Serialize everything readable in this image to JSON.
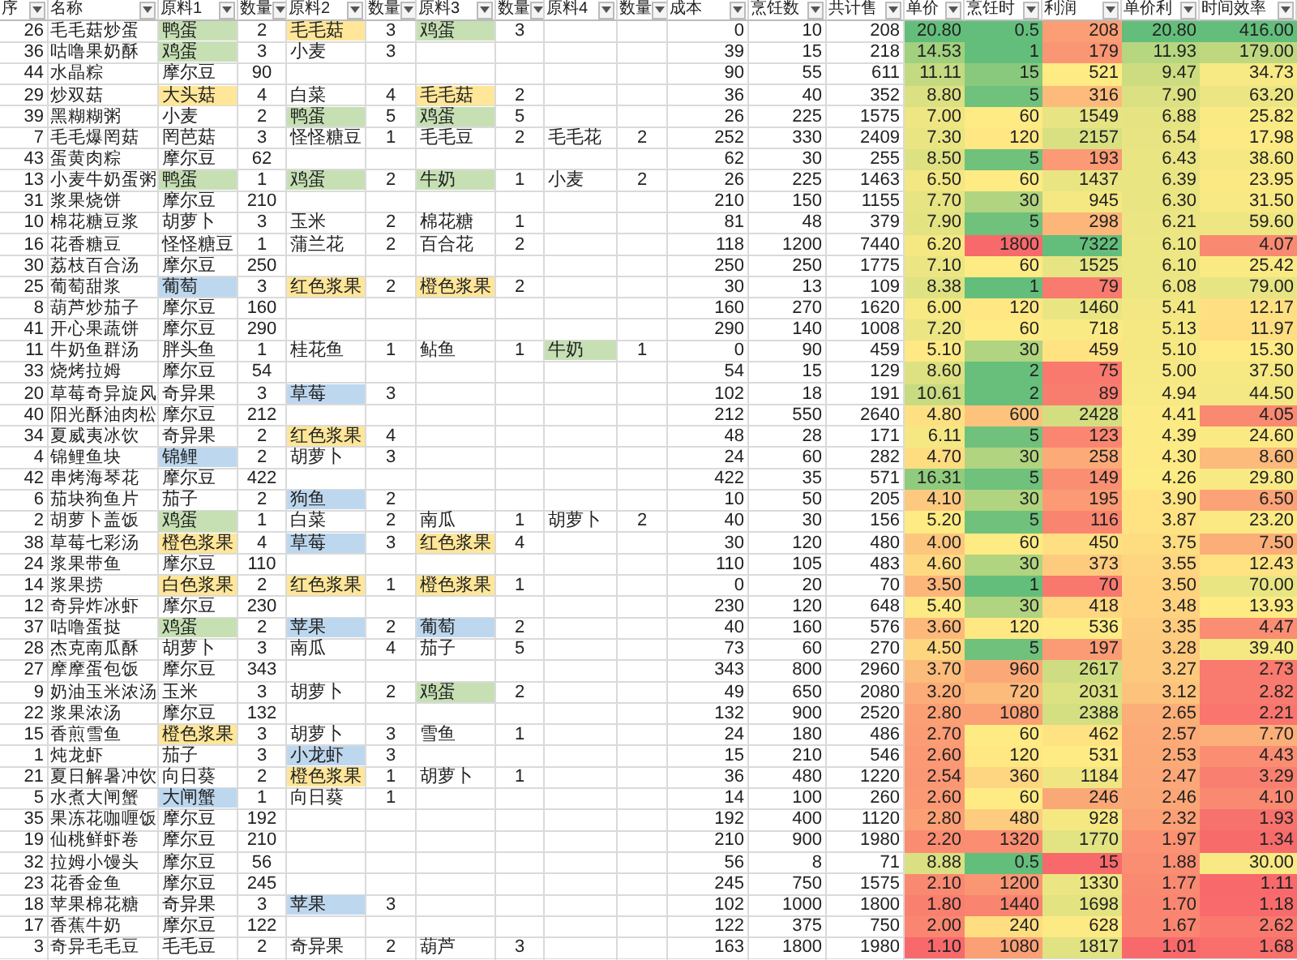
{
  "table": {
    "columns": [
      "序",
      "名称",
      "原料1",
      "数量",
      "原料2",
      "数量",
      "原料3",
      "数量",
      "原料4",
      "数量",
      "成本",
      "烹饪数",
      "共计售",
      "单价",
      "烹饪时",
      "利润",
      "单价利",
      "时间效率"
    ],
    "rows": [
      {
        "id": "26",
        "name": "毛毛菇炒蛋",
        "ingredients": [
          {
            "name": "鸭蛋",
            "qty": "2",
            "color": "#c6e0b4"
          },
          {
            "name": "毛毛菇",
            "qty": "3",
            "color": "#ffe699"
          },
          {
            "name": "鸡蛋",
            "qty": "3",
            "color": "#c6e0b4"
          }
        ],
        "cost": "0",
        "cook_count": "10",
        "total_price": "208",
        "unit_price": "20.80",
        "cook_time": "0.5",
        "profit": "208",
        "unit_profit": "20.80",
        "time_efficiency": "416.00"
      },
      {
        "id": "36",
        "name": "咕噜果奶酥",
        "ingredients": [
          {
            "name": "鸡蛋",
            "qty": "3",
            "color": "#c6e0b4"
          },
          {
            "name": "小麦",
            "qty": "3"
          }
        ],
        "cost": "39",
        "cook_count": "15",
        "total_price": "218",
        "unit_price": "14.53",
        "cook_time": "1",
        "profit": "179",
        "unit_profit": "11.93",
        "time_efficiency": "179.00"
      },
      {
        "id": "44",
        "name": "水晶粽",
        "ingredients": [
          {
            "name": "摩尔豆",
            "qty": "90"
          }
        ],
        "cost": "90",
        "cook_count": "55",
        "total_price": "611",
        "unit_price": "11.11",
        "cook_time": "15",
        "profit": "521",
        "unit_profit": "9.47",
        "time_efficiency": "34.73"
      },
      {
        "id": "29",
        "name": "炒双菇",
        "ingredients": [
          {
            "name": "大头菇",
            "qty": "4",
            "color": "#ffe699"
          },
          {
            "name": "白菜",
            "qty": "4"
          },
          {
            "name": "毛毛菇",
            "qty": "2",
            "color": "#ffe699"
          }
        ],
        "cost": "36",
        "cook_count": "40",
        "total_price": "352",
        "unit_price": "8.80",
        "cook_time": "5",
        "profit": "316",
        "unit_profit": "7.90",
        "time_efficiency": "63.20"
      },
      {
        "id": "39",
        "name": "黑糊糊粥",
        "ingredients": [
          {
            "name": "小麦",
            "qty": "2"
          },
          {
            "name": "鸭蛋",
            "qty": "5",
            "color": "#c6e0b4"
          },
          {
            "name": "鸡蛋",
            "qty": "5",
            "color": "#c6e0b4"
          }
        ],
        "cost": "26",
        "cook_count": "225",
        "total_price": "1575",
        "unit_price": "7.00",
        "cook_time": "60",
        "profit": "1549",
        "unit_profit": "6.88",
        "time_efficiency": "25.82"
      },
      {
        "id": "7",
        "name": "毛毛爆罔菇",
        "ingredients": [
          {
            "name": "罔芭菇",
            "qty": "3"
          },
          {
            "name": "怪怪糖豆",
            "qty": "1"
          },
          {
            "name": "毛毛豆",
            "qty": "2"
          },
          {
            "name": "毛毛花",
            "qty": "2"
          }
        ],
        "cost": "252",
        "cook_count": "330",
        "total_price": "2409",
        "unit_price": "7.30",
        "cook_time": "120",
        "profit": "2157",
        "unit_profit": "6.54",
        "time_efficiency": "17.98"
      },
      {
        "id": "43",
        "name": "蛋黄肉粽",
        "ingredients": [
          {
            "name": "摩尔豆",
            "qty": "62"
          }
        ],
        "cost": "62",
        "cook_count": "30",
        "total_price": "255",
        "unit_price": "8.50",
        "cook_time": "5",
        "profit": "193",
        "unit_profit": "6.43",
        "time_efficiency": "38.60"
      },
      {
        "id": "13",
        "name": "小麦牛奶蛋粥",
        "ingredients": [
          {
            "name": "鸭蛋",
            "qty": "1",
            "color": "#c6e0b4"
          },
          {
            "name": "鸡蛋",
            "qty": "2",
            "color": "#c6e0b4"
          },
          {
            "name": "牛奶",
            "qty": "1",
            "color": "#c6e0b4"
          },
          {
            "name": "小麦",
            "qty": "2"
          }
        ],
        "cost": "26",
        "cook_count": "225",
        "total_price": "1463",
        "unit_price": "6.50",
        "cook_time": "60",
        "profit": "1437",
        "unit_profit": "6.39",
        "time_efficiency": "23.95"
      },
      {
        "id": "31",
        "name": "浆果烧饼",
        "ingredients": [
          {
            "name": "摩尔豆",
            "qty": "210"
          }
        ],
        "cost": "210",
        "cook_count": "150",
        "total_price": "1155",
        "unit_price": "7.70",
        "cook_time": "30",
        "profit": "945",
        "unit_profit": "6.30",
        "time_efficiency": "31.50"
      },
      {
        "id": "10",
        "name": "棉花糖豆浆",
        "ingredients": [
          {
            "name": "胡萝卜",
            "qty": "3"
          },
          {
            "name": "玉米",
            "qty": "2"
          },
          {
            "name": "棉花糖",
            "qty": "1"
          }
        ],
        "cost": "81",
        "cook_count": "48",
        "total_price": "379",
        "unit_price": "7.90",
        "cook_time": "5",
        "profit": "298",
        "unit_profit": "6.21",
        "time_efficiency": "59.60"
      },
      {
        "id": "16",
        "name": "花香糖豆",
        "ingredients": [
          {
            "name": "怪怪糖豆",
            "qty": "1"
          },
          {
            "name": "蒲兰花",
            "qty": "2"
          },
          {
            "name": "百合花",
            "qty": "2"
          }
        ],
        "cost": "118",
        "cook_count": "1200",
        "total_price": "7440",
        "unit_price": "6.20",
        "cook_time": "1800",
        "profit": "7322",
        "unit_profit": "6.10",
        "time_efficiency": "4.07"
      },
      {
        "id": "30",
        "name": "荔枝百合汤",
        "ingredients": [
          {
            "name": "摩尔豆",
            "qty": "250"
          }
        ],
        "cost": "250",
        "cook_count": "250",
        "total_price": "1775",
        "unit_price": "7.10",
        "cook_time": "60",
        "profit": "1525",
        "unit_profit": "6.10",
        "time_efficiency": "25.42"
      },
      {
        "id": "25",
        "name": "葡萄甜浆",
        "ingredients": [
          {
            "name": "葡萄",
            "qty": "3",
            "color": "#bdd7ee"
          },
          {
            "name": "红色浆果",
            "qty": "2",
            "color": "#ffe699"
          },
          {
            "name": "橙色浆果",
            "qty": "2",
            "color": "#ffe699"
          }
        ],
        "cost": "30",
        "cook_count": "13",
        "total_price": "109",
        "unit_price": "8.38",
        "cook_time": "1",
        "profit": "79",
        "unit_profit": "6.08",
        "time_efficiency": "79.00"
      },
      {
        "id": "8",
        "name": "葫芦炒茄子",
        "ingredients": [
          {
            "name": "摩尔豆",
            "qty": "160"
          }
        ],
        "cost": "160",
        "cook_count": "270",
        "total_price": "1620",
        "unit_price": "6.00",
        "cook_time": "120",
        "profit": "1460",
        "unit_profit": "5.41",
        "time_efficiency": "12.17"
      },
      {
        "id": "41",
        "name": "开心果蔬饼",
        "ingredients": [
          {
            "name": "摩尔豆",
            "qty": "290"
          }
        ],
        "cost": "290",
        "cook_count": "140",
        "total_price": "1008",
        "unit_price": "7.20",
        "cook_time": "60",
        "profit": "718",
        "unit_profit": "5.13",
        "time_efficiency": "11.97"
      },
      {
        "id": "11",
        "name": "牛奶鱼群汤",
        "ingredients": [
          {
            "name": "胖头鱼",
            "qty": "1"
          },
          {
            "name": "桂花鱼",
            "qty": "1"
          },
          {
            "name": "鲇鱼",
            "qty": "1"
          },
          {
            "name": "牛奶",
            "qty": "1",
            "color": "#c6e0b4"
          }
        ],
        "cost": "0",
        "cook_count": "90",
        "total_price": "459",
        "unit_price": "5.10",
        "cook_time": "30",
        "profit": "459",
        "unit_profit": "5.10",
        "time_efficiency": "15.30"
      },
      {
        "id": "33",
        "name": "烧烤拉姆",
        "ingredients": [
          {
            "name": "摩尔豆",
            "qty": "54"
          }
        ],
        "cost": "54",
        "cook_count": "15",
        "total_price": "129",
        "unit_price": "8.60",
        "cook_time": "2",
        "profit": "75",
        "unit_profit": "5.00",
        "time_efficiency": "37.50"
      },
      {
        "id": "20",
        "name": "草莓奇异旋风",
        "ingredients": [
          {
            "name": "奇异果",
            "qty": "3"
          },
          {
            "name": "草莓",
            "qty": "3",
            "color": "#bdd7ee"
          }
        ],
        "cost": "102",
        "cook_count": "18",
        "total_price": "191",
        "unit_price": "10.61",
        "cook_time": "2",
        "profit": "89",
        "unit_profit": "4.94",
        "time_efficiency": "44.50"
      },
      {
        "id": "40",
        "name": "阳光酥油肉松",
        "ingredients": [
          {
            "name": "摩尔豆",
            "qty": "212"
          }
        ],
        "cost": "212",
        "cook_count": "550",
        "total_price": "2640",
        "unit_price": "4.80",
        "cook_time": "600",
        "profit": "2428",
        "unit_profit": "4.41",
        "time_efficiency": "4.05"
      },
      {
        "id": "34",
        "name": "夏威夷冰饮",
        "ingredients": [
          {
            "name": "奇异果",
            "qty": "2"
          },
          {
            "name": "红色浆果",
            "qty": "4",
            "color": "#ffe699"
          }
        ],
        "cost": "48",
        "cook_count": "28",
        "total_price": "171",
        "unit_price": "6.11",
        "cook_time": "5",
        "profit": "123",
        "unit_profit": "4.39",
        "time_efficiency": "24.60"
      },
      {
        "id": "4",
        "name": "锦鲤鱼块",
        "ingredients": [
          {
            "name": "锦鲤",
            "qty": "2",
            "color": "#bdd7ee"
          },
          {
            "name": "胡萝卜",
            "qty": "3"
          }
        ],
        "cost": "24",
        "cook_count": "60",
        "total_price": "282",
        "unit_price": "4.70",
        "cook_time": "30",
        "profit": "258",
        "unit_profit": "4.30",
        "time_efficiency": "8.60"
      },
      {
        "id": "42",
        "name": "串烤海琴花",
        "ingredients": [
          {
            "name": "摩尔豆",
            "qty": "422"
          }
        ],
        "cost": "422",
        "cook_count": "35",
        "total_price": "571",
        "unit_price": "16.31",
        "cook_time": "5",
        "profit": "149",
        "unit_profit": "4.26",
        "time_efficiency": "29.80"
      },
      {
        "id": "6",
        "name": "茄块狗鱼片",
        "ingredients": [
          {
            "name": "茄子",
            "qty": "2"
          },
          {
            "name": "狗鱼",
            "qty": "2",
            "color": "#bdd7ee"
          }
        ],
        "cost": "10",
        "cook_count": "50",
        "total_price": "205",
        "unit_price": "4.10",
        "cook_time": "30",
        "profit": "195",
        "unit_profit": "3.90",
        "time_efficiency": "6.50"
      },
      {
        "id": "2",
        "name": "胡萝卜盖饭",
        "ingredients": [
          {
            "name": "鸡蛋",
            "qty": "1",
            "color": "#c6e0b4"
          },
          {
            "name": "白菜",
            "qty": "2"
          },
          {
            "name": "南瓜",
            "qty": "1"
          },
          {
            "name": "胡萝卜",
            "qty": "2"
          }
        ],
        "cost": "40",
        "cook_count": "30",
        "total_price": "156",
        "unit_price": "5.20",
        "cook_time": "5",
        "profit": "116",
        "unit_profit": "3.87",
        "time_efficiency": "23.20"
      },
      {
        "id": "38",
        "name": "草莓七彩汤",
        "ingredients": [
          {
            "name": "橙色浆果",
            "qty": "4",
            "color": "#ffe699"
          },
          {
            "name": "草莓",
            "qty": "3",
            "color": "#bdd7ee"
          },
          {
            "name": "红色浆果",
            "qty": "4",
            "color": "#ffe699"
          }
        ],
        "cost": "30",
        "cook_count": "120",
        "total_price": "480",
        "unit_price": "4.00",
        "cook_time": "60",
        "profit": "450",
        "unit_profit": "3.75",
        "time_efficiency": "7.50"
      },
      {
        "id": "24",
        "name": "浆果带鱼",
        "ingredients": [
          {
            "name": "摩尔豆",
            "qty": "110"
          }
        ],
        "cost": "110",
        "cook_count": "105",
        "total_price": "483",
        "unit_price": "4.60",
        "cook_time": "30",
        "profit": "373",
        "unit_profit": "3.55",
        "time_efficiency": "12.43"
      },
      {
        "id": "14",
        "name": "浆果捞",
        "ingredients": [
          {
            "name": "白色浆果",
            "qty": "2",
            "color": "#ffe699"
          },
          {
            "name": "红色浆果",
            "qty": "1",
            "color": "#ffe699"
          },
          {
            "name": "橙色浆果",
            "qty": "1",
            "color": "#ffe699"
          }
        ],
        "cost": "0",
        "cook_count": "20",
        "total_price": "70",
        "unit_price": "3.50",
        "cook_time": "1",
        "profit": "70",
        "unit_profit": "3.50",
        "time_efficiency": "70.00"
      },
      {
        "id": "12",
        "name": "奇异炸冰虾",
        "ingredients": [
          {
            "name": "摩尔豆",
            "qty": "230"
          }
        ],
        "cost": "230",
        "cook_count": "120",
        "total_price": "648",
        "unit_price": "5.40",
        "cook_time": "30",
        "profit": "418",
        "unit_profit": "3.48",
        "time_efficiency": "13.93"
      },
      {
        "id": "37",
        "name": "咕噜蛋挞",
        "ingredients": [
          {
            "name": "鸡蛋",
            "qty": "2",
            "color": "#c6e0b4"
          },
          {
            "name": "苹果",
            "qty": "2",
            "color": "#bdd7ee"
          },
          {
            "name": "葡萄",
            "qty": "2",
            "color": "#bdd7ee"
          }
        ],
        "cost": "40",
        "cook_count": "160",
        "total_price": "576",
        "unit_price": "3.60",
        "cook_time": "120",
        "profit": "536",
        "unit_profit": "3.35",
        "time_efficiency": "4.47"
      },
      {
        "id": "28",
        "name": "杰克南瓜酥",
        "ingredients": [
          {
            "name": "胡萝卜",
            "qty": "3"
          },
          {
            "name": "南瓜",
            "qty": "4"
          },
          {
            "name": "茄子",
            "qty": "5"
          }
        ],
        "cost": "73",
        "cook_count": "60",
        "total_price": "270",
        "unit_price": "4.50",
        "cook_time": "5",
        "profit": "197",
        "unit_profit": "3.28",
        "time_efficiency": "39.40"
      },
      {
        "id": "27",
        "name": "摩摩蛋包饭",
        "ingredients": [
          {
            "name": "摩尔豆",
            "qty": "343"
          }
        ],
        "cost": "343",
        "cook_count": "800",
        "total_price": "2960",
        "unit_price": "3.70",
        "cook_time": "960",
        "profit": "2617",
        "unit_profit": "3.27",
        "time_efficiency": "2.73"
      },
      {
        "id": "9",
        "name": "奶油玉米浓汤",
        "ingredients": [
          {
            "name": "玉米",
            "qty": "3"
          },
          {
            "name": "胡萝卜",
            "qty": "2"
          },
          {
            "name": "鸡蛋",
            "qty": "2",
            "color": "#c6e0b4"
          }
        ],
        "cost": "49",
        "cook_count": "650",
        "total_price": "2080",
        "unit_price": "3.20",
        "cook_time": "720",
        "profit": "2031",
        "unit_profit": "3.12",
        "time_efficiency": "2.82"
      },
      {
        "id": "22",
        "name": "浆果浓汤",
        "ingredients": [
          {
            "name": "摩尔豆",
            "qty": "132"
          }
        ],
        "cost": "132",
        "cook_count": "900",
        "total_price": "2520",
        "unit_price": "2.80",
        "cook_time": "1080",
        "profit": "2388",
        "unit_profit": "2.65",
        "time_efficiency": "2.21"
      },
      {
        "id": "15",
        "name": "香煎雪鱼",
        "ingredients": [
          {
            "name": "橙色浆果",
            "qty": "3",
            "color": "#ffe699"
          },
          {
            "name": "胡萝卜",
            "qty": "3"
          },
          {
            "name": "雪鱼",
            "qty": "1"
          }
        ],
        "cost": "24",
        "cook_count": "180",
        "total_price": "486",
        "unit_price": "2.70",
        "cook_time": "60",
        "profit": "462",
        "unit_profit": "2.57",
        "time_efficiency": "7.70"
      },
      {
        "id": "1",
        "name": "炖龙虾",
        "ingredients": [
          {
            "name": "茄子",
            "qty": "3"
          },
          {
            "name": "小龙虾",
            "qty": "3",
            "color": "#bdd7ee"
          }
        ],
        "cost": "15",
        "cook_count": "210",
        "total_price": "546",
        "unit_price": "2.60",
        "cook_time": "120",
        "profit": "531",
        "unit_profit": "2.53",
        "time_efficiency": "4.43"
      },
      {
        "id": "21",
        "name": "夏日解暑冲饮",
        "ingredients": [
          {
            "name": "向日葵",
            "qty": "2"
          },
          {
            "name": "橙色浆果",
            "qty": "1",
            "color": "#ffe699"
          },
          {
            "name": "胡萝卜",
            "qty": "1"
          }
        ],
        "cost": "36",
        "cook_count": "480",
        "total_price": "1220",
        "unit_price": "2.54",
        "cook_time": "360",
        "profit": "1184",
        "unit_profit": "2.47",
        "time_efficiency": "3.29"
      },
      {
        "id": "5",
        "name": "水煮大闸蟹",
        "ingredients": [
          {
            "name": "大闸蟹",
            "qty": "1",
            "color": "#bdd7ee"
          },
          {
            "name": "向日葵",
            "qty": "1"
          }
        ],
        "cost": "14",
        "cook_count": "100",
        "total_price": "260",
        "unit_price": "2.60",
        "cook_time": "60",
        "profit": "246",
        "unit_profit": "2.46",
        "time_efficiency": "4.10"
      },
      {
        "id": "35",
        "name": "果冻花咖喱饭",
        "ingredients": [
          {
            "name": "摩尔豆",
            "qty": "192"
          }
        ],
        "cost": "192",
        "cook_count": "400",
        "total_price": "1120",
        "unit_price": "2.80",
        "cook_time": "480",
        "profit": "928",
        "unit_profit": "2.32",
        "time_efficiency": "1.93"
      },
      {
        "id": "19",
        "name": "仙桃鲜虾卷",
        "ingredients": [
          {
            "name": "摩尔豆",
            "qty": "210"
          }
        ],
        "cost": "210",
        "cook_count": "900",
        "total_price": "1980",
        "unit_price": "2.20",
        "cook_time": "1320",
        "profit": "1770",
        "unit_profit": "1.97",
        "time_efficiency": "1.34"
      },
      {
        "id": "32",
        "name": "拉姆小馒头",
        "ingredients": [
          {
            "name": "摩尔豆",
            "qty": "56"
          }
        ],
        "cost": "56",
        "cook_count": "8",
        "total_price": "71",
        "unit_price": "8.88",
        "cook_time": "0.5",
        "profit": "15",
        "unit_profit": "1.88",
        "time_efficiency": "30.00"
      },
      {
        "id": "23",
        "name": "花香金鱼",
        "ingredients": [
          {
            "name": "摩尔豆",
            "qty": "245"
          }
        ],
        "cost": "245",
        "cook_count": "750",
        "total_price": "1575",
        "unit_price": "2.10",
        "cook_time": "1200",
        "profit": "1330",
        "unit_profit": "1.77",
        "time_efficiency": "1.11"
      },
      {
        "id": "18",
        "name": "苹果棉花糖",
        "ingredients": [
          {
            "name": "奇异果",
            "qty": "3"
          },
          {
            "name": "苹果",
            "qty": "3",
            "color": "#bdd7ee"
          }
        ],
        "cost": "102",
        "cook_count": "1000",
        "total_price": "1800",
        "unit_price": "1.80",
        "cook_time": "1440",
        "profit": "1698",
        "unit_profit": "1.70",
        "time_efficiency": "1.18"
      },
      {
        "id": "17",
        "name": "香蕉牛奶",
        "ingredients": [
          {
            "name": "摩尔豆",
            "qty": "122"
          }
        ],
        "cost": "122",
        "cook_count": "375",
        "total_price": "750",
        "unit_price": "2.00",
        "cook_time": "240",
        "profit": "628",
        "unit_profit": "1.67",
        "time_efficiency": "2.62"
      },
      {
        "id": "3",
        "name": "奇异毛毛豆",
        "ingredients": [
          {
            "name": "毛毛豆",
            "qty": "2"
          },
          {
            "name": "奇异果",
            "qty": "2"
          },
          {
            "name": "葫芦",
            "qty": "3"
          }
        ],
        "cost": "163",
        "cook_count": "1800",
        "total_price": "1980",
        "unit_price": "1.10",
        "cook_time": "1080",
        "profit": "1817",
        "unit_profit": "1.01",
        "time_efficiency": "1.68"
      }
    ]
  }
}
